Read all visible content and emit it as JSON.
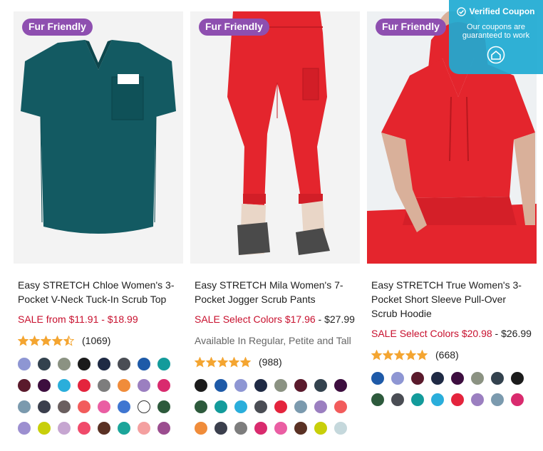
{
  "coupon": {
    "title": "Verified Coupon",
    "subtitle": "Our coupons are guaranteed to work"
  },
  "products": [
    {
      "badge": "Fur Friendly",
      "title": "Easy STRETCH Chloe Women's 3-Pocket V-Neck Tuck-In Scrub Top",
      "sale_text": "SALE from $11.91 - $18.99",
      "regular_price": "",
      "availability": "",
      "rating": 4.5,
      "review_count": "(1069)",
      "garment_color": "#135a62",
      "swatches": [
        "#8e96d3",
        "#33424e",
        "#8b9282",
        "#1b1b1b",
        "#1f2a44",
        "#4a4d54",
        "#1e5aa8",
        "#139b9b",
        "#5a1a2c",
        "#3d0e3f",
        "#2aaedb",
        "#e4243d",
        "#7d7d7d",
        "#f08c3a",
        "#9b7fc0",
        "#d92b6e",
        "#7b9aae",
        "#3b3f4d",
        "#6a5f5f",
        "#f25c5c",
        "#ea5ea3",
        "#3f76d1",
        "#ffffff",
        "#2d5a3c",
        "#9c8fd0",
        "#c8cf0a",
        "#c6a6d1",
        "#f04a6a",
        "#5a3124",
        "#1ba59a",
        "#f4a0a0",
        "#9b4d8f"
      ]
    },
    {
      "badge": "Fur Friendly",
      "title": "Easy STRETCH Mila Women's 7-Pocket Jogger Scrub Pants",
      "sale_text": "SALE Select Colors $17.96",
      "regular_price": " - $27.99",
      "availability": "Available In Regular, Petite and Tall",
      "rating": 5,
      "review_count": "(988)",
      "garment_color": "#e4252d",
      "swatches": [
        "#1b1b1b",
        "#1e5aa8",
        "#8e96d3",
        "#1f2a44",
        "#8b9282",
        "#5a1a2c",
        "#33424e",
        "#3d0e3f",
        "#2d5a3c",
        "#139b9b",
        "#2aaedb",
        "#4a4d54",
        "#e4243d",
        "#7b9aae",
        "#9b7fc0",
        "#f25c5c",
        "#f08c3a",
        "#3b3f4d",
        "#7d7d7d",
        "#d92b6e",
        "#ea5ea3",
        "#5a3124",
        "#c8cf0a",
        "#c5d8dc"
      ]
    },
    {
      "badge": "Fur Friendly",
      "title": "Easy STRETCH True Women's 3-Pocket Short Sleeve Pull-Over Scrub Hoodie",
      "sale_text": "SALE Select Colors $20.98",
      "regular_price": " - $26.99",
      "availability": "",
      "rating": 5,
      "review_count": "(668)",
      "garment_color": "#e4252d",
      "swatches": [
        "#1e5aa8",
        "#8e96d3",
        "#5a1a2c",
        "#1f2a44",
        "#3d0e3f",
        "#8b9282",
        "#33424e",
        "#1b1b1b",
        "#2d5a3c",
        "#4a4d54",
        "#139b9b",
        "#2aaedb",
        "#e4243d",
        "#9b7fc0",
        "#7b9aae",
        "#d92b6e"
      ]
    }
  ]
}
